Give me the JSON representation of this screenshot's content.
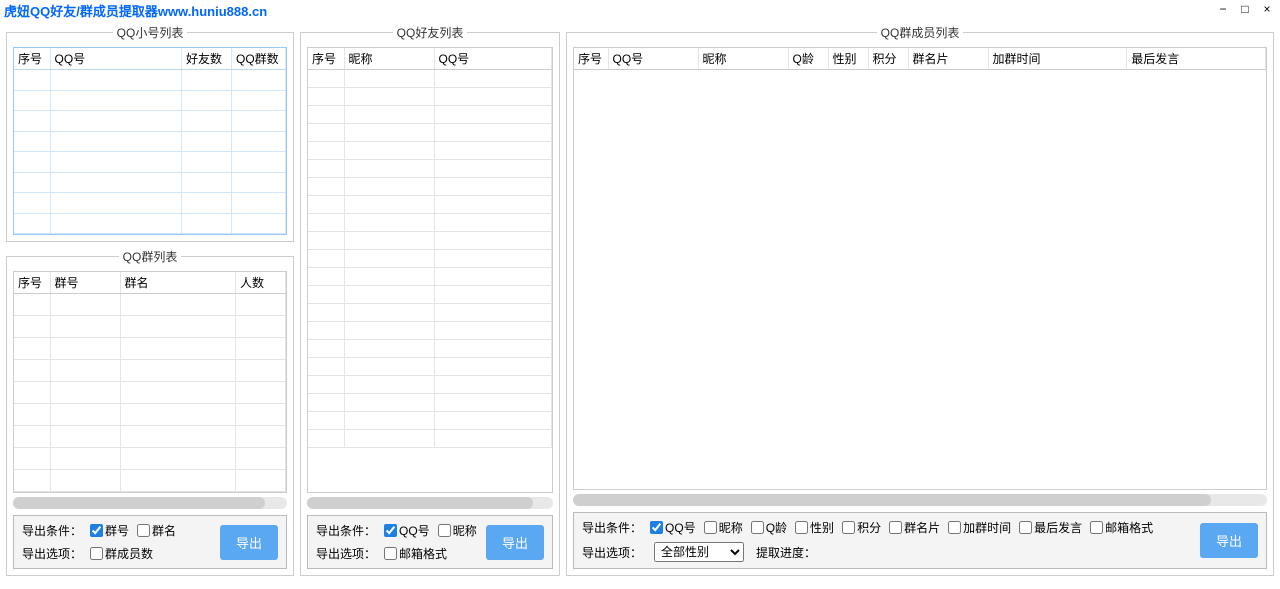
{
  "title": "虎妞QQ好友/群成员提取器www.huniu888.cn",
  "panels": {
    "accounts": {
      "title": "QQ小号列表",
      "cols": [
        "序号",
        "QQ号",
        "好友数",
        "QQ群数"
      ]
    },
    "groups": {
      "title": "QQ群列表",
      "cols": [
        "序号",
        "群号",
        "群名",
        "人数"
      ]
    },
    "friends": {
      "title": "QQ好友列表",
      "cols": [
        "序号",
        "昵称",
        "QQ号"
      ]
    },
    "members": {
      "title": "QQ群成员列表",
      "cols": [
        "序号",
        "QQ号",
        "昵称",
        "Q龄",
        "性别",
        "积分",
        "群名片",
        "加群时间",
        "最后发言"
      ]
    }
  },
  "export": {
    "cond_label": "导出条件：",
    "opt_label": "导出选项：",
    "progress_label": "提取进度：",
    "btn": "导出",
    "groups": {
      "chk_groupno": "群号",
      "chk_groupname": "群名",
      "chk_membercount": "群成员数"
    },
    "friends": {
      "chk_qq": "QQ号",
      "chk_nick": "昵称",
      "chk_mail": "邮箱格式"
    },
    "members": {
      "chk_qq": "QQ号",
      "chk_nick": "昵称",
      "chk_qage": "Q龄",
      "chk_gender": "性别",
      "chk_score": "积分",
      "chk_card": "群名片",
      "chk_jointime": "加群时间",
      "chk_lastspeak": "最后发言",
      "chk_mail": "邮箱格式",
      "gender_all": "全部性别"
    }
  }
}
